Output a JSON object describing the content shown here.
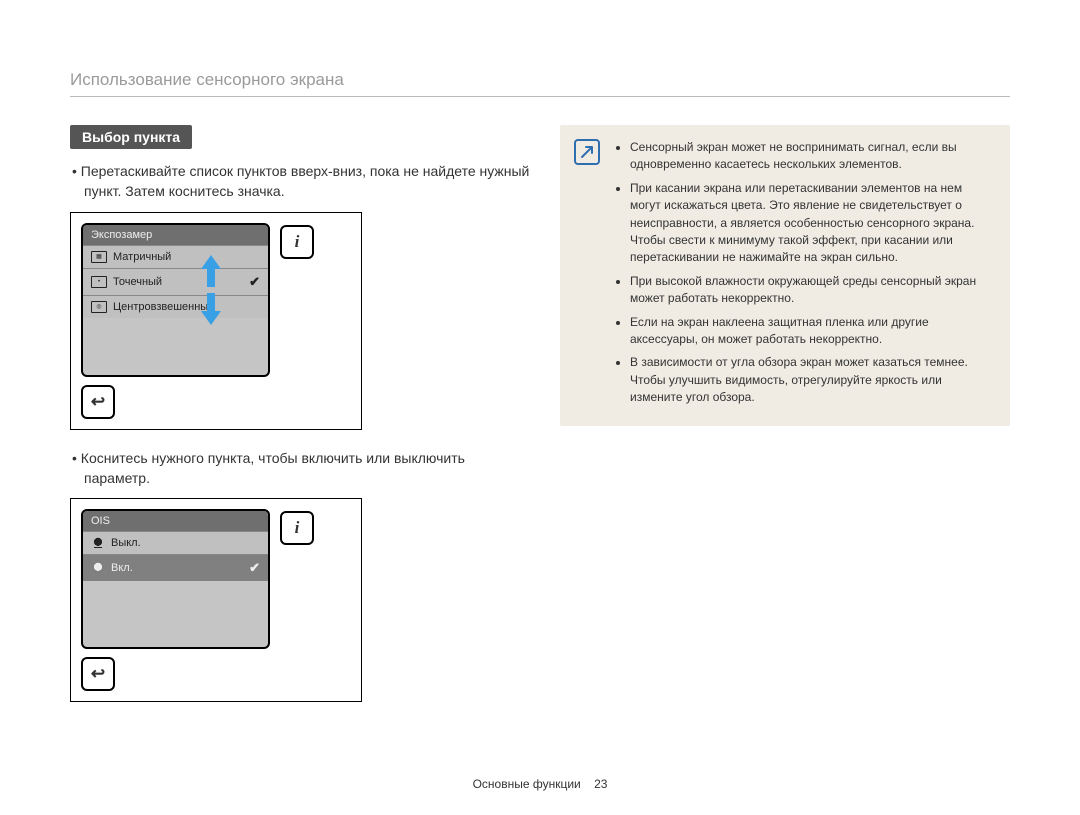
{
  "header": {
    "title": "Использование сенсорного экрана"
  },
  "left": {
    "section_label": "Выбор пункта",
    "bullet1": "Перетаскивайте список пунктов вверх-вниз, пока не найдете нужный пункт. Затем коснитесь значка.",
    "bullet2": "Коснитесь нужного пункта, чтобы включить или выключить параметр.",
    "fig1": {
      "header": "Экспозамер",
      "item1": "Матричный",
      "item2": "Точечный",
      "item3": "Центровзвешенный",
      "info": "i",
      "back": "↩"
    },
    "fig2": {
      "header": "OIS",
      "item1": "Выкл.",
      "item2": "Вкл.",
      "info": "i",
      "back": "↩"
    }
  },
  "notes": {
    "n1": "Сенсорный экран может не воспринимать сигнал, если вы одновременно касаетесь нескольких элементов.",
    "n2": "При касании экрана или перетаскивании элементов на нем могут искажаться цвета. Это явление не свидетельствует о неисправности, а является особенностью сенсорного экрана. Чтобы свести к минимуму такой эффект, при касании или перетаскивании не нажимайте на экран сильно.",
    "n3": "При высокой влажности окружающей среды сенсорный экран может работать некорректно.",
    "n4": "Если на экран наклеена защитная пленка или другие аксессуары, он может работать некорректно.",
    "n5": "В зависимости от угла обзора экран может казаться темнее. Чтобы улучшить видимость, отрегулируйте яркость или измените угол обзора."
  },
  "footer": {
    "section": "Основные функции",
    "page": "23"
  }
}
